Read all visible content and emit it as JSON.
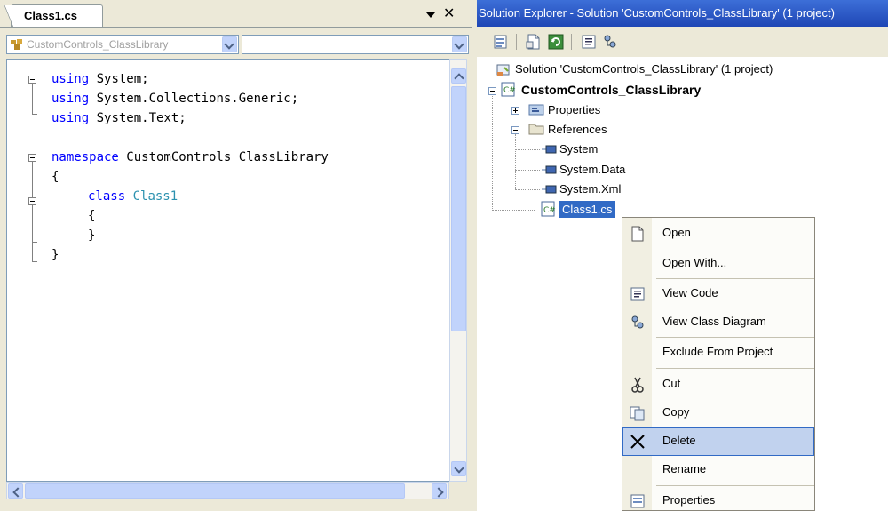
{
  "editor": {
    "tab_label": "Class1.cs",
    "close_glyph": "✕",
    "type_combo_label": "CustomControls_ClassLibrary",
    "member_combo_label": "",
    "code_lines": [
      {
        "kw": "using",
        "rest": " System;"
      },
      {
        "kw": "using",
        "rest": " System.Collections.Generic;"
      },
      {
        "kw": "using",
        "rest": " System.Text;"
      },
      {
        "kw": "",
        "rest": ""
      },
      {
        "kw": "namespace",
        "rest": " CustomControls_ClassLibrary"
      },
      {
        "kw": "",
        "rest": "{"
      },
      {
        "kw": "class",
        "rest": " ",
        "type": "Class1"
      },
      {
        "kw": "",
        "rest": "{"
      },
      {
        "kw": "",
        "rest": "}"
      },
      {
        "kw": "",
        "rest": "}"
      }
    ]
  },
  "explorer": {
    "title": "Solution Explorer - Solution 'CustomControls_ClassLibrary' (1 project)",
    "toolbar_icons": [
      "properties-icon",
      "show-all-files-icon",
      "refresh-icon",
      "view-code-icon",
      "view-class-diagram-icon"
    ],
    "tree": {
      "solution": "Solution 'CustomControls_ClassLibrary' (1 project)",
      "project": "CustomControls_ClassLibrary",
      "properties": "Properties",
      "references": "References",
      "refs": [
        "System",
        "System.Data",
        "System.Xml"
      ],
      "file": "Class1.cs"
    }
  },
  "context_menu": {
    "items": [
      {
        "label": "Open",
        "icon": "open-icon"
      },
      {
        "label": "Open With...",
        "icon": ""
      },
      {
        "label": "View Code",
        "icon": "view-code-icon"
      },
      {
        "label": "View Class Diagram",
        "icon": "class-diagram-icon"
      },
      {
        "label": "Exclude From Project",
        "icon": ""
      },
      {
        "label": "Cut",
        "icon": "cut-icon"
      },
      {
        "label": "Copy",
        "icon": "copy-icon"
      },
      {
        "label": "Delete",
        "icon": "delete-icon"
      },
      {
        "label": "Rename",
        "icon": ""
      },
      {
        "label": "Properties",
        "icon": "properties-icon"
      }
    ],
    "highlighted": "Delete"
  },
  "colors": {
    "keyword": "#0000ff",
    "type": "#2b91af",
    "title_bar": "#2a55c5",
    "selection": "#316ac5"
  }
}
